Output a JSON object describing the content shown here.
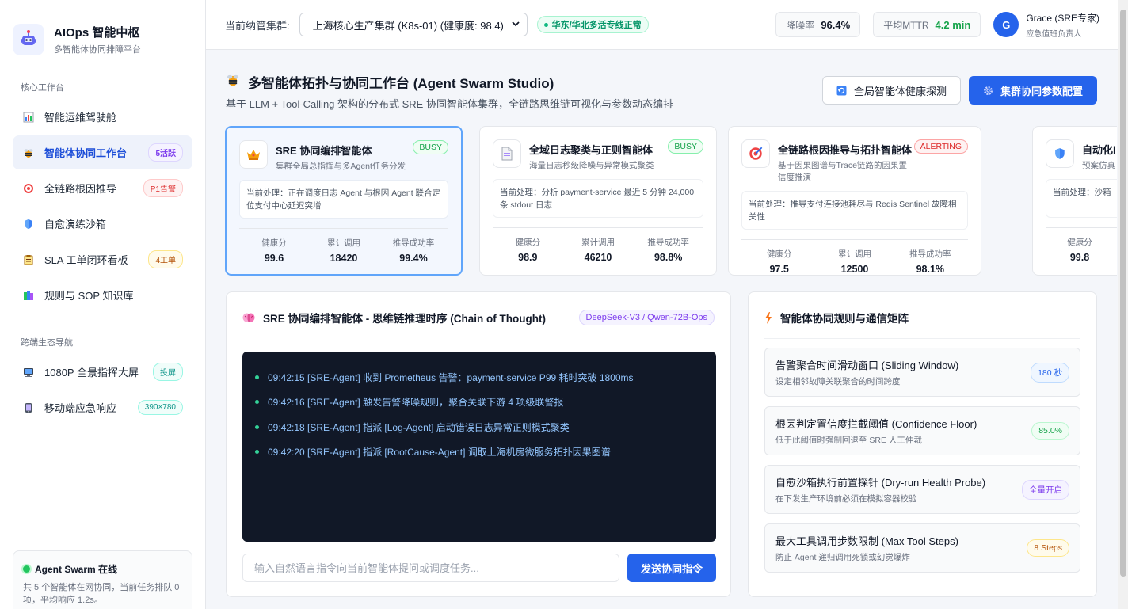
{
  "brand": {
    "title": "AIOps 智能中枢",
    "subtitle": "多智能体协同排障平台"
  },
  "sidebar": {
    "section_core": "核心工作台",
    "section_cross": "跨端生态导航",
    "items": [
      {
        "label": "智能运维驾驶舱",
        "icon": "chart-icon",
        "badge": ""
      },
      {
        "label": "智能体协同工作台",
        "icon": "bee-icon",
        "badge": "5活跃"
      },
      {
        "label": "全链路根因推导",
        "icon": "target-icon",
        "badge": "P1告警"
      },
      {
        "label": "自愈演练沙箱",
        "icon": "shield-icon",
        "badge": ""
      },
      {
        "label": "SLA 工单闭环看板",
        "icon": "clipboard-icon",
        "badge": "4工单"
      },
      {
        "label": "规则与 SOP 知识库",
        "icon": "books-icon",
        "badge": ""
      }
    ],
    "cross_items": [
      {
        "label": "1080P 全景指挥大屏",
        "icon": "monitor-icon",
        "badge": "投屏"
      },
      {
        "label": "移动端应急响应",
        "icon": "mobile-icon",
        "badge": "390×780"
      }
    ],
    "swarm": {
      "title": "Agent Swarm 在线",
      "desc": "共 5 个智能体在网协同，当前任务排队 0 项，平均响应 1.2s。"
    }
  },
  "topbar": {
    "cluster_label": "当前纳管集群:",
    "cluster_value": "上海核心生产集群 (K8s-01) (健康度: 98.4)",
    "status": "华东/华北多活专线正常",
    "noise_label": "降噪率",
    "noise_value": "96.4%",
    "mttr_label": "平均MTTR",
    "mttr_value": "4.2 min",
    "user_initial": "G",
    "user_name": "Grace (SRE专家)",
    "user_role": "应急值班负责人"
  },
  "page": {
    "title": "多智能体拓扑与协同工作台 (Agent Swarm Studio)",
    "subtitle": "基于 LLM + Tool-Calling 架构的分布式 SRE 协同智能体集群，全链路思维链可视化与参数动态编排",
    "btn_probe": "全局智能体健康探测",
    "btn_config": "集群协同参数配置"
  },
  "agents": [
    {
      "name": "SRE 协同编排智能体",
      "desc": "集群全局总指挥与多Agent任务分发",
      "state": "BUSY",
      "task": "当前处理：正在调度日志 Agent 与根因 Agent 联合定位支付中心延迟突增",
      "k1": "健康分",
      "v1": "99.6",
      "k2": "累计调用",
      "v2": "18420",
      "k3": "推导成功率",
      "v3": "99.4%"
    },
    {
      "name": "全域日志聚类与正则智能体",
      "desc": "海量日志秒级降噪与异常模式聚类",
      "state": "BUSY",
      "task": "当前处理：分析 payment-service 最近 5 分钟 24,000 条 stdout 日志",
      "k1": "健康分",
      "v1": "98.9",
      "k2": "累计调用",
      "v2": "46210",
      "k3": "推导成功率",
      "v3": "98.8%"
    },
    {
      "name": "全链路根因推导与拓扑智能体",
      "desc": "基于因果图谱与Trace链路的因果置信度推演",
      "state": "ALERTING",
      "task": "当前处理：推导支付连接池耗尽与 Redis Sentinel 故障相关性",
      "k1": "健康分",
      "v1": "97.5",
      "k2": "累计调用",
      "v2": "12500",
      "k3": "推导成功率",
      "v3": "98.1%"
    },
    {
      "name": "自动化l",
      "desc": "预案仿真",
      "state": "",
      "task": "当前处理：沙箱",
      "k1": "健康分",
      "v1": "99.8",
      "k2": "",
      "v2": "",
      "k3": "",
      "v3": ""
    }
  ],
  "cot": {
    "title": "SRE 协同编排智能体 - 思维链推理时序 (Chain of Thought)",
    "model": "DeepSeek-V3 / Qwen-72B-Ops",
    "logs": [
      "09:42:15 [SRE-Agent] 收到 Prometheus 告警：payment-service P99 耗时突破 1800ms",
      "09:42:16 [SRE-Agent] 触发告警降噪规则，聚合关联下游 4 项级联警报",
      "09:42:18 [SRE-Agent] 指派 [Log-Agent] 启动错误日志异常正则模式聚类",
      "09:42:20 [SRE-Agent] 指派 [RootCause-Agent] 调取上海机房微服务拓扑因果图谱"
    ],
    "input_placeholder": "输入自然语言指令向当前智能体提问或调度任务...",
    "send": "发送协同指令"
  },
  "rules": {
    "title": "智能体协同规则与通信矩阵",
    "items": [
      {
        "name": "告警聚合时间滑动窗口 (Sliding Window)",
        "desc": "设定相邻故障关联聚合的时间跨度",
        "value": "180 秒"
      },
      {
        "name": "根因判定置信度拦截阈值 (Confidence Floor)",
        "desc": "低于此阈值时强制回退至 SRE 人工仲裁",
        "value": "85.0%"
      },
      {
        "name": "自愈沙箱执行前置探针 (Dry-run Health Probe)",
        "desc": "在下发生产环境前必须在模拟容器校验",
        "value": "全量开启"
      },
      {
        "name": "最大工具调用步数限制 (Max Tool Steps)",
        "desc": "防止 Agent 递归调用死锁或幻觉爆炸",
        "value": "8 Steps"
      }
    ]
  }
}
